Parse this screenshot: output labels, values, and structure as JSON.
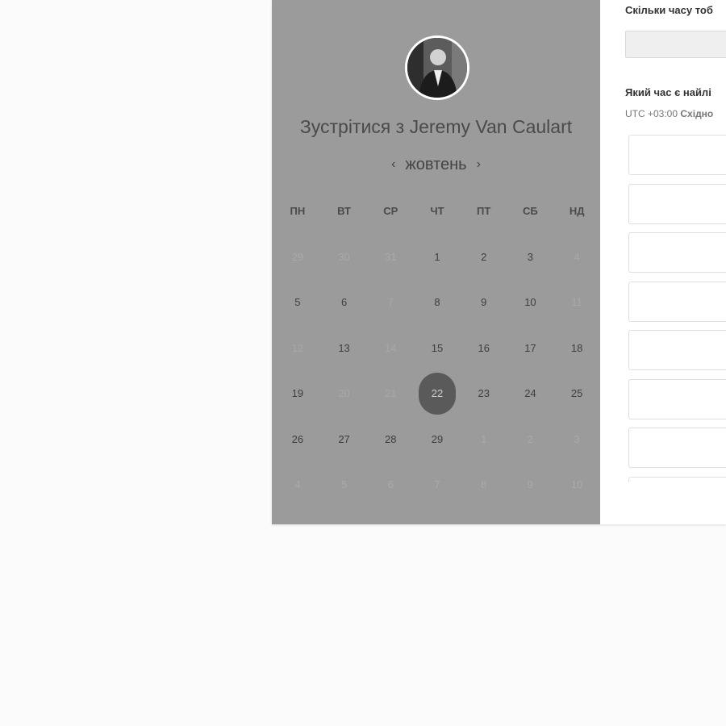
{
  "scheduler": {
    "meet_prefix": "Зустрітися з",
    "host_name": "Jeremy Van Caulart",
    "month": "жовтень",
    "prev_icon": "‹",
    "next_icon": "›",
    "weekdays": [
      "ПН",
      "ВТ",
      "СР",
      "ЧТ",
      "ПТ",
      "СБ",
      "НД"
    ],
    "selected_day": "22",
    "days": [
      {
        "label": "29",
        "state": "muted"
      },
      {
        "label": "30",
        "state": "muted"
      },
      {
        "label": "31",
        "state": "muted"
      },
      {
        "label": "1",
        "state": "available"
      },
      {
        "label": "2",
        "state": "available"
      },
      {
        "label": "3",
        "state": "available"
      },
      {
        "label": "4",
        "state": "disabled"
      },
      {
        "label": "5",
        "state": "available"
      },
      {
        "label": "6",
        "state": "available"
      },
      {
        "label": "7",
        "state": "disabled"
      },
      {
        "label": "8",
        "state": "available"
      },
      {
        "label": "9",
        "state": "available"
      },
      {
        "label": "10",
        "state": "available"
      },
      {
        "label": "11",
        "state": "disabled"
      },
      {
        "label": "12",
        "state": "disabled"
      },
      {
        "label": "13",
        "state": "available"
      },
      {
        "label": "14",
        "state": "disabled"
      },
      {
        "label": "15",
        "state": "available"
      },
      {
        "label": "16",
        "state": "available"
      },
      {
        "label": "17",
        "state": "available"
      },
      {
        "label": "18",
        "state": "available"
      },
      {
        "label": "19",
        "state": "available"
      },
      {
        "label": "20",
        "state": "disabled"
      },
      {
        "label": "21",
        "state": "disabled"
      },
      {
        "label": "22",
        "state": "selected"
      },
      {
        "label": "23",
        "state": "available"
      },
      {
        "label": "24",
        "state": "available"
      },
      {
        "label": "25",
        "state": "available"
      },
      {
        "label": "26",
        "state": "available"
      },
      {
        "label": "27",
        "state": "available"
      },
      {
        "label": "28",
        "state": "available"
      },
      {
        "label": "29",
        "state": "available"
      },
      {
        "label": "1",
        "state": "muted"
      },
      {
        "label": "2",
        "state": "muted"
      },
      {
        "label": "3",
        "state": "muted"
      },
      {
        "label": "4",
        "state": "muted"
      },
      {
        "label": "5",
        "state": "muted"
      },
      {
        "label": "6",
        "state": "muted"
      },
      {
        "label": "7",
        "state": "muted"
      },
      {
        "label": "8",
        "state": "muted"
      },
      {
        "label": "9",
        "state": "muted"
      },
      {
        "label": "10",
        "state": "muted"
      }
    ]
  },
  "booking": {
    "duration_question": "Скільки часу тоб",
    "time_question": "Який час є найлі",
    "timezone_offset": "UTC +03:00",
    "timezone_name": "Східно",
    "slot_count": 8
  }
}
